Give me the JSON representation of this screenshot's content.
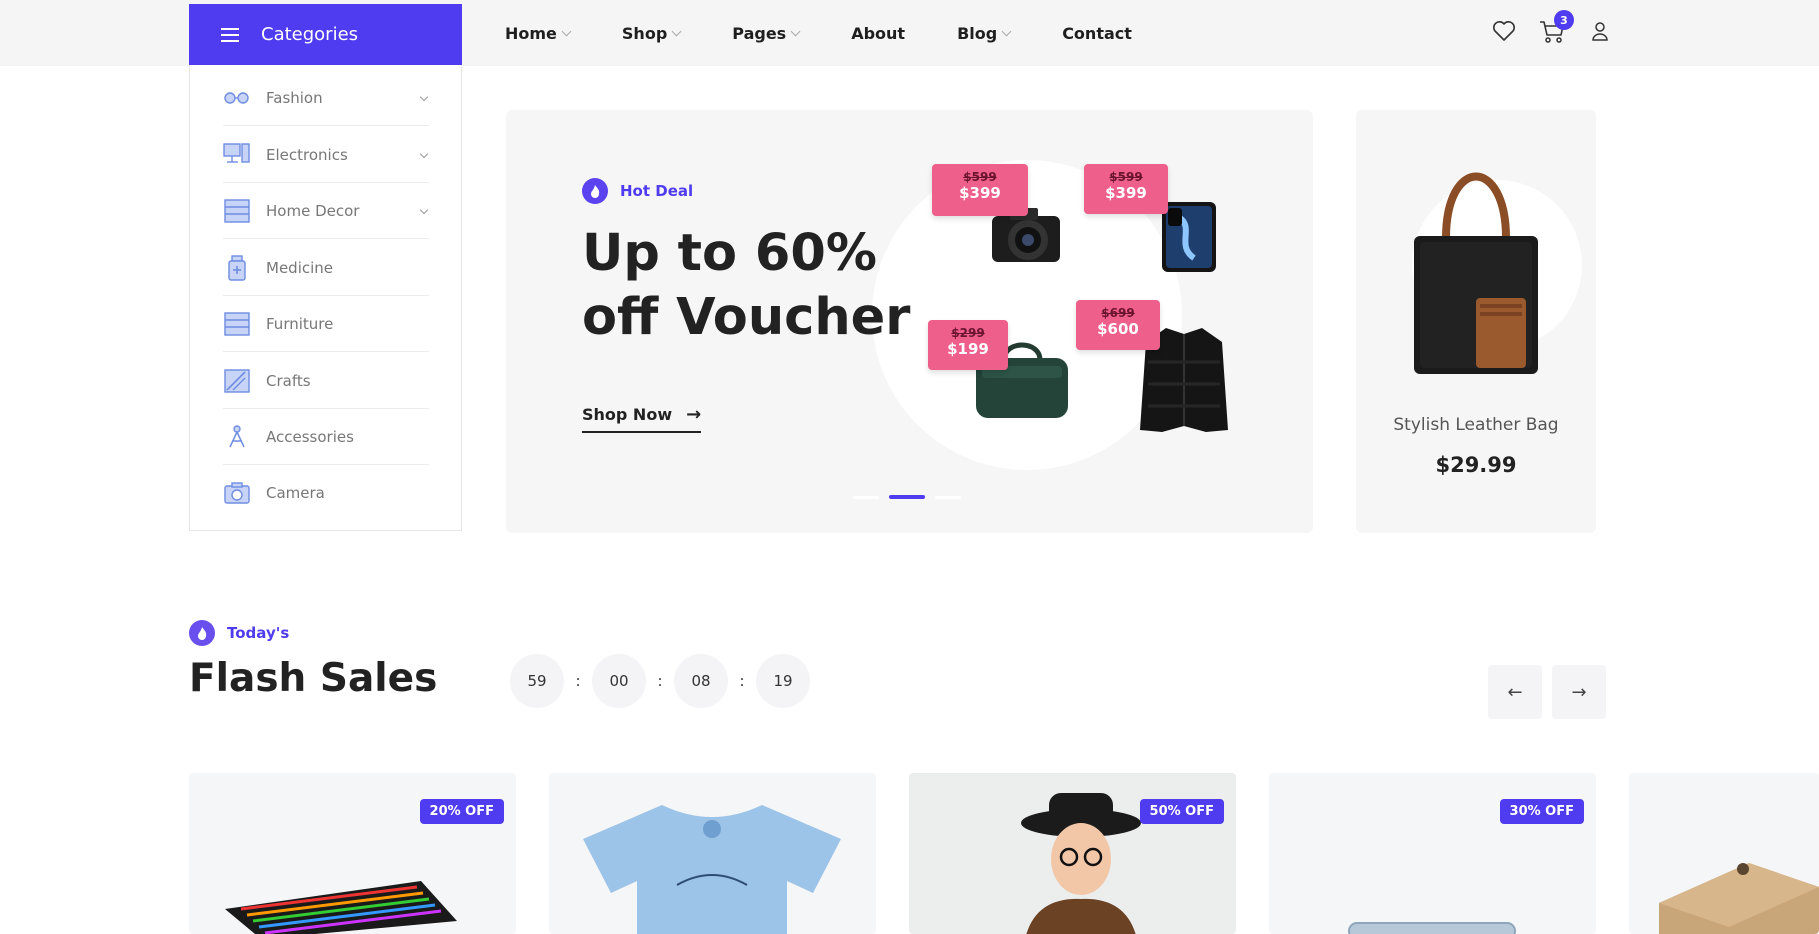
{
  "header": {
    "categories_label": "Categories",
    "nav": [
      {
        "label": "Home",
        "dropdown": true
      },
      {
        "label": "Shop",
        "dropdown": true
      },
      {
        "label": "Pages",
        "dropdown": true
      },
      {
        "label": "About",
        "dropdown": false
      },
      {
        "label": "Blog",
        "dropdown": true
      },
      {
        "label": "Contact",
        "dropdown": false
      }
    ],
    "cart_count": "3",
    "icons": [
      "heart-icon",
      "cart-icon",
      "user-icon"
    ]
  },
  "sidebar": {
    "items": [
      {
        "label": "Fashion",
        "icon": "glasses-icon",
        "expandable": true
      },
      {
        "label": "Electronics",
        "icon": "computer-icon",
        "expandable": true
      },
      {
        "label": "Home Decor",
        "icon": "drawer-icon",
        "expandable": true
      },
      {
        "label": "Medicine",
        "icon": "medicine-icon",
        "expandable": false
      },
      {
        "label": "Furniture",
        "icon": "cabinet-icon",
        "expandable": false
      },
      {
        "label": "Crafts",
        "icon": "crafts-icon",
        "expandable": false
      },
      {
        "label": "Accessories",
        "icon": "accessories-icon",
        "expandable": false
      },
      {
        "label": "Camera",
        "icon": "camera-icon",
        "expandable": false
      }
    ]
  },
  "hero": {
    "tag": "Hot Deal",
    "title": "Up to 60% off Voucher",
    "cta": "Shop Now",
    "prices": [
      {
        "old": "$599",
        "new": "$399"
      },
      {
        "old": "$599",
        "new": "$399"
      },
      {
        "old": "$299",
        "new": "$199"
      },
      {
        "old": "$699",
        "new": "$600"
      }
    ],
    "slides": 3,
    "active_slide": 2
  },
  "side_product": {
    "name": "Stylish Leather Bag",
    "price": "$29.99"
  },
  "flash": {
    "tag": "Today's",
    "title": "Flash Sales",
    "timer": [
      "59",
      "00",
      "08",
      "19"
    ],
    "separator": ":",
    "prev": "←",
    "next": "→"
  },
  "products": [
    {
      "badge": "20% OFF"
    },
    {
      "badge": ""
    },
    {
      "badge": "50% OFF"
    },
    {
      "badge": "30% OFF"
    },
    {
      "badge": ""
    }
  ],
  "colors": {
    "accent": "#4f3bf0",
    "tag_pink": "#ef5f8c",
    "card_bg": "#f6f6f7"
  }
}
